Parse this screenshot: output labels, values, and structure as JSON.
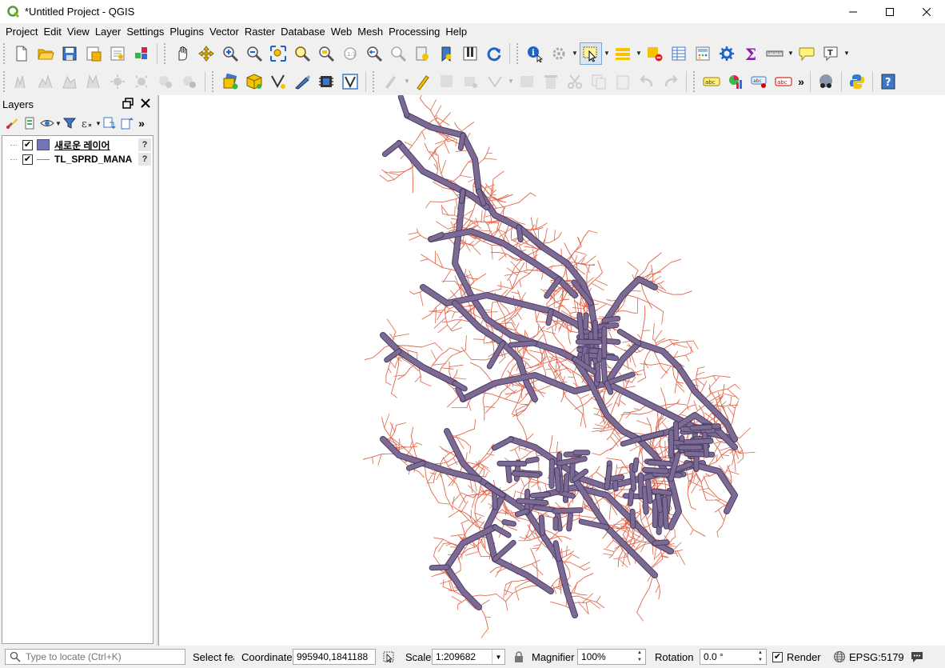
{
  "window": {
    "title": "*Untitled Project - QGIS",
    "controls": [
      "minimize",
      "maximize",
      "close"
    ]
  },
  "menu": [
    "Project",
    "Edit",
    "View",
    "Layer",
    "Settings",
    "Plugins",
    "Vector",
    "Raster",
    "Database",
    "Web",
    "Mesh",
    "Processing",
    "Help"
  ],
  "toolbar1": [
    "new-project-icon",
    "open-project-icon",
    "save-project-icon",
    "save-as-icon",
    "print-layout-icon",
    "style-manager-icon",
    "pan-icon",
    "pan-to-selection-icon",
    "zoom-in-icon",
    "zoom-out-icon",
    "zoom-full-icon",
    "zoom-to-selection-icon",
    "zoom-to-layer-icon",
    "zoom-native-icon",
    "zoom-last-icon",
    "zoom-next-icon",
    "new-bookmark-icon",
    "show-bookmarks-icon",
    "temporal-controller-icon",
    "refresh-icon",
    "identify-icon",
    "actions-icon",
    "select-features-icon",
    "select-by-value-icon",
    "deselect-icon",
    "attribute-table-icon",
    "field-calculator-icon",
    "processing-toolbox-icon",
    "statistics-icon",
    "measure-icon",
    "map-tips-icon",
    "text-annotation-icon"
  ],
  "toolbar2": [
    "digitizing-tools-icons",
    "data-source-manager-icon",
    "new-geopackage-layer-icon",
    "vertex-tool-icon",
    "digitize-icon",
    "gps-icon",
    "georeferencer-icon",
    "current-edits-icon",
    "toggle-editing-icon",
    "label-icons",
    "python-console-icon",
    "help-icon"
  ],
  "layers_panel": {
    "title": "Layers",
    "layers": [
      {
        "name": "새로운 레이어",
        "checked": true,
        "symbol": "fill",
        "color": "#7474b8",
        "current": true
      },
      {
        "name": "TL_SPRD_MANA",
        "checked": true,
        "symbol": "line",
        "color": "#e0664a",
        "current": false
      }
    ]
  },
  "map": {
    "road_color": "#e0664a",
    "polygon_fill": "#7c6a94",
    "polygon_stroke": "#4a3f66"
  },
  "statusbar": {
    "locator_placeholder": "Type to locate (Ctrl+K)",
    "select_label": "Select fea",
    "coordinate_label": "Coordinate",
    "coordinate_value": "995940,1841188",
    "scale_label": "Scale",
    "scale_value": "1:209682",
    "magnifier_label": "Magnifier",
    "magnifier_value": "100%",
    "rotation_label": "Rotation",
    "rotation_value": "0.0 °",
    "render_label": "Render",
    "render_checked": true,
    "crs": "EPSG:5179"
  }
}
